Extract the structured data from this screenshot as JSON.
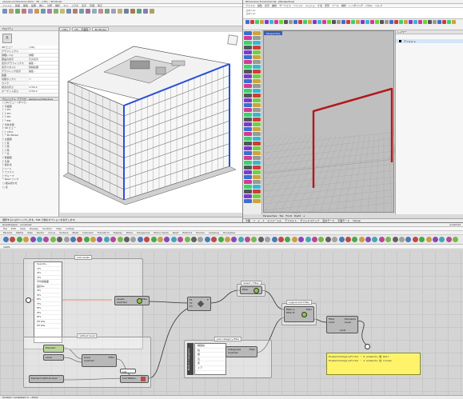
{
  "revit": {
    "title": "sample-architecture-2024 - 3D - {3D} - 3D-Model",
    "tabs": [
      "ファイル",
      "建築",
      "構造",
      "設備",
      "挿入",
      "注釈",
      "解析",
      "マス",
      "コラボ",
      "表示",
      "管理",
      "修正"
    ],
    "ribbon_colors": [
      "#7a8fc0",
      "#c0a070",
      "#6fa86f",
      "#c07a7a",
      "#9a9acc",
      "#cc9a55",
      "#6f9ab0",
      "#b07ab0",
      "#8ab070",
      "#c0c070",
      "#7090b0",
      "#b08070",
      "#70a0a0",
      "#a070a0",
      "#90b0c0",
      "#c09090",
      "#80a080",
      "#a0a0c0",
      "#c0b070",
      "#7080a0",
      "#a08050",
      "#60a080",
      "#8080b0",
      "#b0a060"
    ],
    "view_tabs": [
      "{3D}",
      "1FL - 平面図",
      "3D-Model"
    ],
    "properties": {
      "title": "プロパティ",
      "logo": "R",
      "rows": [
        {
          "k": "3D ビュー",
          "v": "{3D}"
        },
        {
          "k": "グラフィックス",
          "v": ""
        },
        {
          "k": "詳細レベル",
          "v": "詳細"
        },
        {
          "k": "部品の表示",
          "v": "元の表示"
        },
        {
          "k": "表示/グラフィックス",
          "v": "編集..."
        },
        {
          "k": "表示スタイル",
          "v": "隠線処理"
        },
        {
          "k": "グラフィック表示",
          "v": "編集..."
        },
        {
          "k": "範囲",
          "v": ""
        },
        {
          "k": "切断ボックス",
          "v": "☐"
        },
        {
          "k": "カメラ",
          "v": ""
        },
        {
          "k": "視点の高さ",
          "v": "1750.0"
        },
        {
          "k": "ターゲット高さ",
          "v": "1750.0"
        }
      ],
      "browser_title": "プロジェクト ブラウザ - sample-architecture",
      "tree": [
        "□ [0] ビュー (すべて)",
        "  ├ 平面図",
        "  │  ├ 1FL",
        "  │  ├ 2FL",
        "  │  ├ 3FL",
        "  │  └ RFL",
        "  ├ 天井伏図",
        "  ├ 3D ビュー",
        "  │  ├ {3D}",
        "  │  └ 3D-Model",
        "  ├ 立面図",
        "  │  ├ 東",
        "  │  ├ 西",
        "  │  ├ 南",
        "  │  └ 北",
        "  ├ 断面図",
        "  ├ 凡例",
        "  ├ 集計表",
        "  ├ シート",
        "  ├ ファミリ",
        "  ├ グループ",
        "  └ Revit リンク",
        "□ 組み合わせ",
        "□ 表"
      ]
    },
    "status": "選択するにはクリックします。TAB で他のオプションを表示します。"
  },
  "rhino": {
    "title": "Rhinoceros 8 Commercial - [Perspective]",
    "menu": [
      "ファイル",
      "編集",
      "表示",
      "曲線",
      "サーフェス",
      "ソリッド",
      "メッシュ",
      "寸法",
      "変形",
      "ツール",
      "解析",
      "レンダリング",
      "パネル",
      "ヘルプ"
    ],
    "command_lines": [
      "コマンド:",
      "コマンド:"
    ],
    "toolbar_colors": [
      "#3b6fd1",
      "#d13b3b",
      "#3bd16f",
      "#d1a23b",
      "#7a3bd1",
      "#3bb6d1",
      "#d13b98",
      "#6fd13b",
      "#555",
      "#999"
    ],
    "viewport_title": "Perspective",
    "panel": {
      "tab": "レイヤー",
      "layer": "デフォルト"
    },
    "viewport_tabs": [
      "Perspective",
      "Top",
      "Front",
      "Right",
      "+"
    ],
    "status_items": [
      "平面",
      "x",
      "y",
      "z",
      "ミリメートル",
      "デフォルト",
      "グリッドスナップ",
      "直交モード",
      "平面モード",
      "Osnap"
    ]
  },
  "grasshopper": {
    "title": "Grasshopper - unnamed",
    "title_right": "unnamed",
    "menu": [
      "File",
      "Edit",
      "View",
      "Display",
      "Solution",
      "Help",
      "unHelp"
    ],
    "categories": [
      "Params",
      "Maths",
      "Sets",
      "Vector",
      "Curve",
      "Surface",
      "Mesh",
      "Intersect",
      "Transform",
      "Display",
      "Rhino",
      "Kangaroo2",
      "Rhino.Inside",
      "Revit",
      "Elefront",
      "Human",
      "Ladybug",
      "Honeybee"
    ],
    "comp_colors": [
      "#4a7ab8",
      "#c04848",
      "#48a848",
      "#c8a040",
      "#8848b8",
      "#40a8b8",
      "#b84898",
      "#78b848",
      "#606060",
      "#a0a0a0"
    ],
    "canvas_zoom": "100%",
    "groups": {
      "levels": "pick-levels",
      "filter": "Select / Filter",
      "logical": "Logical And Filter",
      "without_level": "without level",
      "category": "pick-category filter"
    },
    "level_list": {
      "header": "SearchL...",
      "items": [
        "1FL",
        "2FL",
        "3FL",
        "平均地盤面",
        "設計GL",
        "4FL",
        "5FL",
        "6FL",
        "7FL",
        "8FL",
        "9FL",
        "RFL",
        "PH RSL",
        "PH RSL"
      ]
    },
    "nodes": {
      "levels_in": "Levels",
      "levels_sub": "Inverted",
      "filter_out": "Filter",
      "or_a": "F1",
      "or_b": "F2",
      "or_c": "F3",
      "or_out": "F",
      "filter_plus": "Filter",
      "logic_a": "Filter A",
      "logic_b": "Filter B",
      "logic_out": "Filter",
      "elem_in": "Filter",
      "elem_limit": "Limit",
      "elem_level": "Level",
      "elem_out": "Elements",
      "elem_out2": "Limit",
      "level_a": "Element",
      "level_b": "Level",
      "level_c": "Inverted",
      "level_out": "Filter",
      "category_in": "Categories",
      "category_sub": "Inverted",
      "category_out": "Filter",
      "build_label": "Built-In Categories",
      "list_out": "List",
      "cull_label": "Cull Pattern",
      "elements_label": "Element without level"
    },
    "category_list": {
      "items": [
        "柱",
        "壁",
        "窓",
        "床",
        "ドア"
      ],
      "header": "構造柱",
      "rows2": [
        "構造フレーム",
        "構造基礎"
      ]
    },
    "note_lines": [
      "ElementCategoryFilter : 6 elements 壁 Wall",
      "ElementCategoryFilter : 4 elements 柱 Column"
    ],
    "status": "Solution completed in ~15ms"
  }
}
